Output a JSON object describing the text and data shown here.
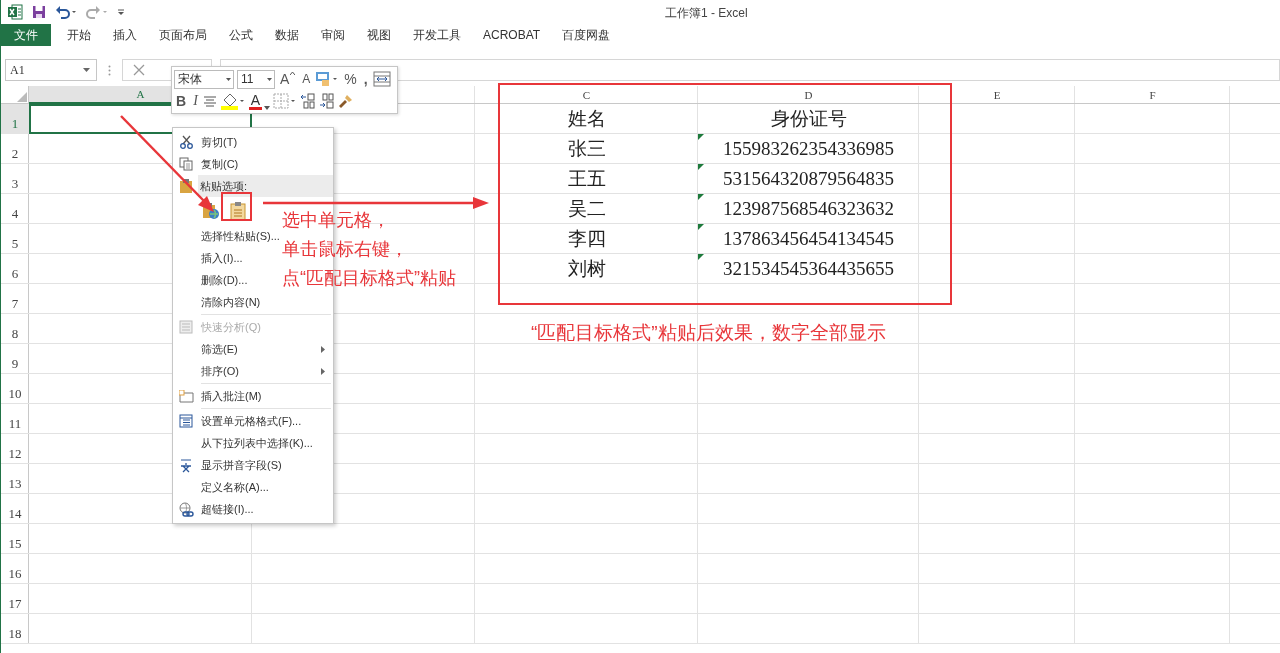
{
  "window": {
    "title": "工作簿1 - Excel"
  },
  "ribbon_tabs": [
    {
      "label": "文件",
      "kind": "file"
    },
    {
      "label": "开始",
      "kind": "tab"
    },
    {
      "label": "插入",
      "kind": "tab"
    },
    {
      "label": "页面布局",
      "kind": "tab"
    },
    {
      "label": "公式",
      "kind": "tab"
    },
    {
      "label": "数据",
      "kind": "tab"
    },
    {
      "label": "审阅",
      "kind": "tab"
    },
    {
      "label": "视图",
      "kind": "tab"
    },
    {
      "label": "开发工具",
      "kind": "tab"
    },
    {
      "label": "ACROBAT",
      "kind": "tab"
    },
    {
      "label": "百度网盘",
      "kind": "tab"
    }
  ],
  "name_box": {
    "value": "A1"
  },
  "mini_toolbar": {
    "font": "宋体",
    "font_size": "11",
    "grow_letter": "A",
    "shrink_letter": "A",
    "percent": "%",
    "comma": ",",
    "bold": "B",
    "italic": "I",
    "font_color_letter": "A"
  },
  "columns": [
    {
      "label": "A",
      "selected": true
    },
    {
      "selected": false
    },
    {
      "label": "C",
      "selected": false
    },
    {
      "label": "D",
      "selected": false
    },
    {
      "label": "E",
      "selected": false
    },
    {
      "label": "F",
      "selected": false
    }
  ],
  "rows": [
    {
      "label": "1",
      "selected": true,
      "c": "姓名",
      "d": "身份证号",
      "number_stored_as_text": false
    },
    {
      "label": "2",
      "selected": false,
      "c": "张三",
      "d": "155983262354336985",
      "number_stored_as_text": true
    },
    {
      "label": "3",
      "selected": false,
      "c": "王五",
      "d": "531564320879564835",
      "number_stored_as_text": true
    },
    {
      "label": "4",
      "selected": false,
      "c": "吴二",
      "d": "123987568546323632",
      "number_stored_as_text": true
    },
    {
      "label": "5",
      "selected": false,
      "c": "李四",
      "d": "137863456454134545",
      "number_stored_as_text": true
    },
    {
      "label": "6",
      "selected": false,
      "c": "刘树",
      "d": "321534545364435655",
      "number_stored_as_text": true
    },
    {
      "label": "7",
      "selected": false
    },
    {
      "label": "8",
      "selected": false
    },
    {
      "label": "9",
      "selected": false
    },
    {
      "label": "10",
      "selected": false
    },
    {
      "label": "11",
      "selected": false
    },
    {
      "label": "12",
      "selected": false
    },
    {
      "label": "13",
      "selected": false
    },
    {
      "label": "14",
      "selected": false
    },
    {
      "label": "15",
      "selected": false
    },
    {
      "label": "16",
      "selected": false
    },
    {
      "label": "17",
      "selected": false
    },
    {
      "label": "18",
      "selected": false
    }
  ],
  "context_menu": {
    "items": [
      {
        "kind": "item",
        "label": "剪切(T)",
        "disabled": false,
        "submenu": false
      },
      {
        "kind": "item",
        "label": "复制(C)",
        "disabled": false,
        "submenu": false
      },
      {
        "kind": "header",
        "label": "粘贴选项:"
      },
      {
        "kind": "paste_options"
      },
      {
        "kind": "item",
        "label": "选择性粘贴(S)...",
        "disabled": false,
        "submenu": false
      },
      {
        "kind": "item",
        "label": "插入(I)...",
        "disabled": false,
        "submenu": false
      },
      {
        "kind": "item",
        "label": "删除(D)...",
        "disabled": false,
        "submenu": false
      },
      {
        "kind": "item",
        "label": "清除内容(N)",
        "disabled": false,
        "submenu": false
      },
      {
        "kind": "separator"
      },
      {
        "kind": "item",
        "label": "快速分析(Q)",
        "disabled": true,
        "submenu": false
      },
      {
        "kind": "item",
        "label": "筛选(E)",
        "disabled": false,
        "submenu": true
      },
      {
        "kind": "item",
        "label": "排序(O)",
        "disabled": false,
        "submenu": true
      },
      {
        "kind": "separator"
      },
      {
        "kind": "item",
        "label": "插入批注(M)",
        "disabled": false,
        "submenu": false
      },
      {
        "kind": "separator"
      },
      {
        "kind": "item",
        "label": "设置单元格格式(F)...",
        "disabled": false,
        "submenu": false
      },
      {
        "kind": "item",
        "label": "从下拉列表中选择(K)...",
        "disabled": false,
        "submenu": false
      },
      {
        "kind": "item",
        "label": "显示拼音字段(S)",
        "disabled": false,
        "submenu": false
      },
      {
        "kind": "item",
        "label": "定义名称(A)...",
        "disabled": false,
        "submenu": false
      },
      {
        "kind": "item",
        "label": "超链接(I)...",
        "disabled": false,
        "submenu": false
      }
    ]
  },
  "annotation": {
    "note": [
      "选中单元格，",
      "单击鼠标右键，",
      "点“匹配目标格式”粘贴"
    ],
    "caption": "“匹配目标格式”粘贴后效果，数字全部显示"
  }
}
